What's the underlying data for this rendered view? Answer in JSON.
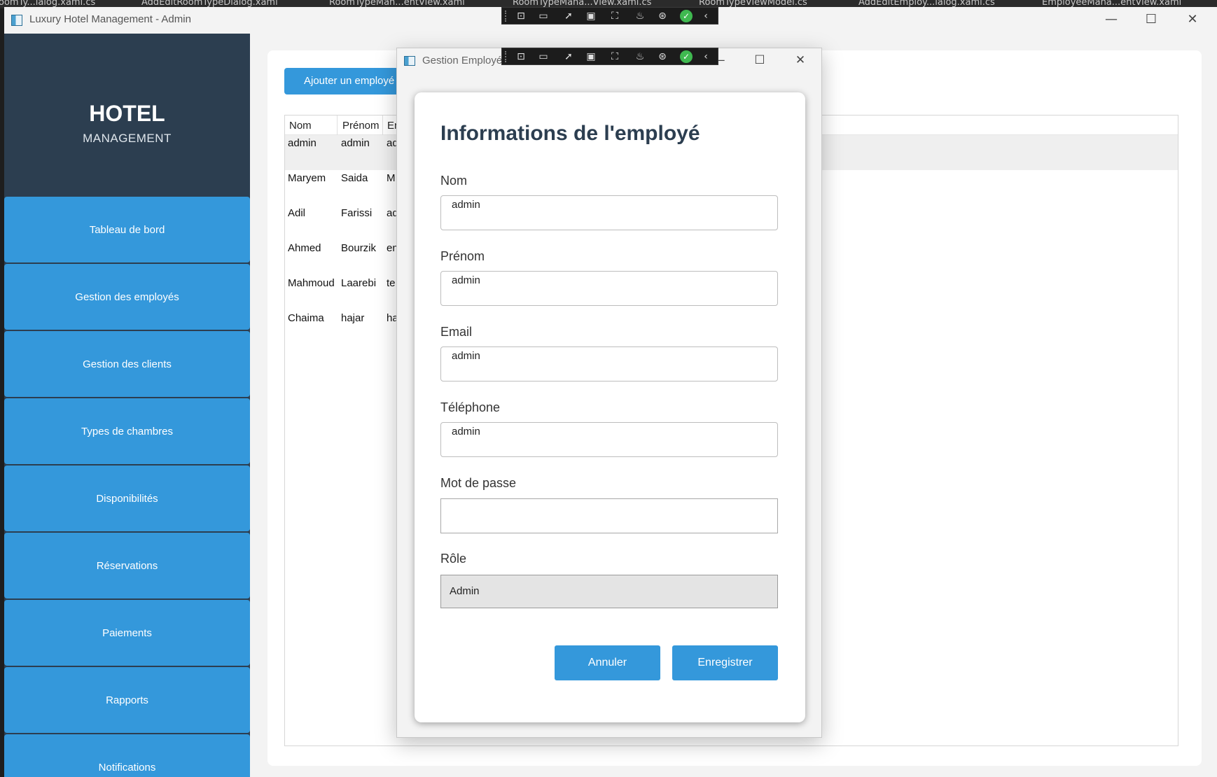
{
  "background_tabs": [
    {
      "label": "oomTy...ialog.xaml.cs"
    },
    {
      "label": "AddEditRoomTypeDialog.xaml"
    },
    {
      "label": "RoomTypeMan...entView.xaml"
    },
    {
      "label": "RoomTypeMana...View.xaml.cs"
    },
    {
      "label": "RoomTypeViewModel.cs"
    },
    {
      "label": "AddEditEmploy...ialog.xaml.cs"
    },
    {
      "label": "EmployeeMana...entView.xaml"
    }
  ],
  "main_window": {
    "title": "Luxury Hotel Management - Admin",
    "controls": {
      "minimize": "—",
      "maximize": "☐",
      "close": "✕"
    }
  },
  "sidebar": {
    "logo_title": "HOTEL",
    "logo_subtitle": "MANAGEMENT",
    "items": [
      {
        "label": "Tableau de bord"
      },
      {
        "label": "Gestion des employés"
      },
      {
        "label": "Gestion des clients"
      },
      {
        "label": "Types de chambres"
      },
      {
        "label": "Disponibilités"
      },
      {
        "label": "Réservations"
      },
      {
        "label": "Paiements"
      },
      {
        "label": "Rapports"
      },
      {
        "label": "Notifications"
      }
    ]
  },
  "content": {
    "add_button": "Ajouter un employé",
    "grid": {
      "columns": [
        "Nom",
        "Prénom",
        "Em"
      ],
      "rows": [
        {
          "nom": "admin",
          "prenom": "admin",
          "email": "ad"
        },
        {
          "nom": "Maryem",
          "prenom": "Saida",
          "email": "M"
        },
        {
          "nom": "Adil",
          "prenom": "Farissi",
          "email": "ad"
        },
        {
          "nom": "Ahmed",
          "prenom": "Bourzik",
          "email": "en"
        },
        {
          "nom": "Mahmoud",
          "prenom": "Laarebi",
          "email": "te"
        },
        {
          "nom": "Chaima",
          "prenom": "hajar",
          "email": "ha"
        }
      ]
    }
  },
  "dialog": {
    "title": "Gestion Employé",
    "controls": {
      "minimize": "—",
      "maximize": "☐",
      "close": "✕"
    },
    "heading": "Informations de l'employé",
    "fields": {
      "nom": {
        "label": "Nom",
        "value": "admin"
      },
      "prenom": {
        "label": "Prénom",
        "value": "admin"
      },
      "email": {
        "label": "Email",
        "value": "admin"
      },
      "telephone": {
        "label": "Téléphone",
        "value": "admin"
      },
      "password": {
        "label": "Mot de passe",
        "value": ""
      },
      "role": {
        "label": "Rôle",
        "value": "Admin"
      }
    },
    "cancel_button": "Annuler",
    "save_button": "Enregistrer"
  },
  "colors": {
    "sidebar_bg": "#2c3e50",
    "accent": "#3498db",
    "heading": "#2c3e50"
  },
  "debug_toolbar_icons": [
    "select-element-icon",
    "record-icon",
    "pointer-icon",
    "frame-icon",
    "adorner-icon",
    "hot-reload-icon",
    "accessibility-icon",
    "check-icon",
    "collapse-icon"
  ]
}
